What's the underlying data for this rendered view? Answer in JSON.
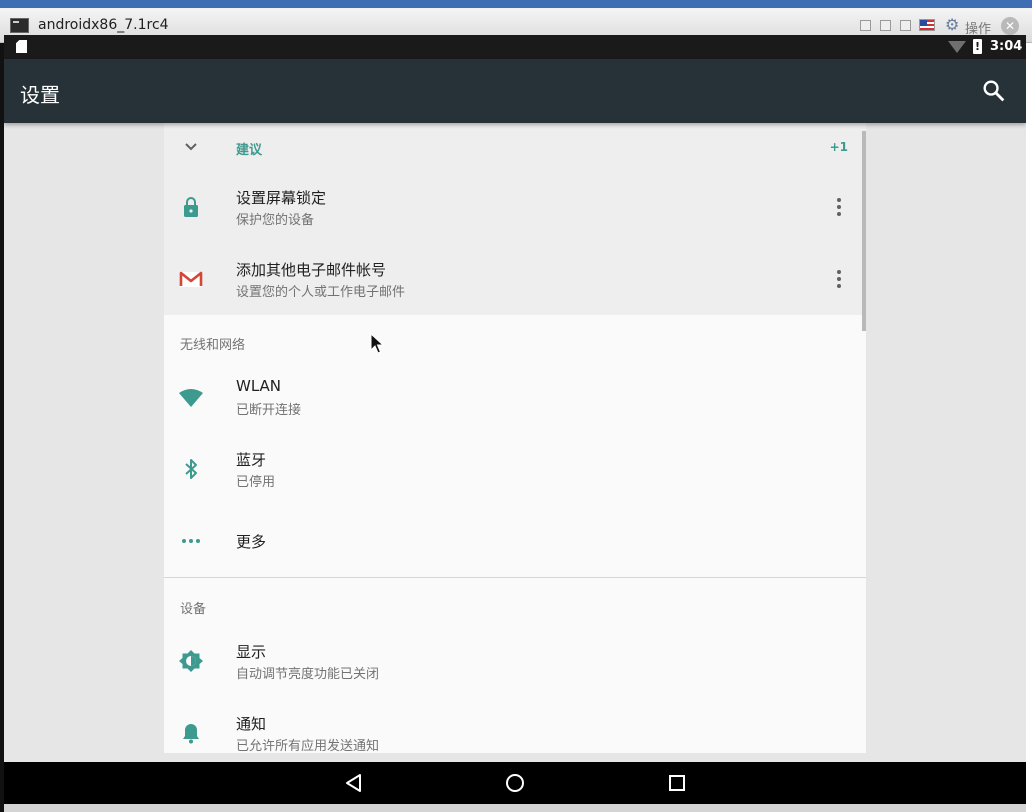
{
  "window": {
    "title": "androidx86_7.1rc4",
    "action_label": "操作",
    "close_glyph": "✕",
    "gear_glyph": "⚙"
  },
  "statusbar": {
    "time": "3:04"
  },
  "appbar": {
    "title": "设置",
    "search_icon": "search-icon"
  },
  "suggestions": {
    "label": "建议",
    "count": "+1",
    "items": [
      {
        "title": "设置屏幕锁定",
        "subtitle": "保护您的设备",
        "icon": "lock-icon"
      },
      {
        "title": "添加其他电子邮件帐号",
        "subtitle": "设置您的个人或工作电子邮件",
        "icon": "gmail-icon"
      }
    ]
  },
  "sections": [
    {
      "header": "无线和网络",
      "items": [
        {
          "title": "WLAN",
          "subtitle": "已断开连接",
          "icon": "wifi-icon"
        },
        {
          "title": "蓝牙",
          "subtitle": "已停用",
          "icon": "bluetooth-icon"
        },
        {
          "title": "更多",
          "subtitle": "",
          "icon": "more-horiz-icon"
        }
      ]
    },
    {
      "header": "设备",
      "items": [
        {
          "title": "显示",
          "subtitle": "自动调节亮度功能已关闭",
          "icon": "brightness-icon"
        },
        {
          "title": "通知",
          "subtitle": "已允许所有应用发送通知",
          "icon": "bell-icon"
        }
      ]
    }
  ],
  "colors": {
    "accent": "#3d9a8e",
    "appbar": "#263238",
    "statusbar": "#1a1a1a",
    "icon_tint": "#3d9a8e",
    "gmail_red": "#d44638"
  }
}
